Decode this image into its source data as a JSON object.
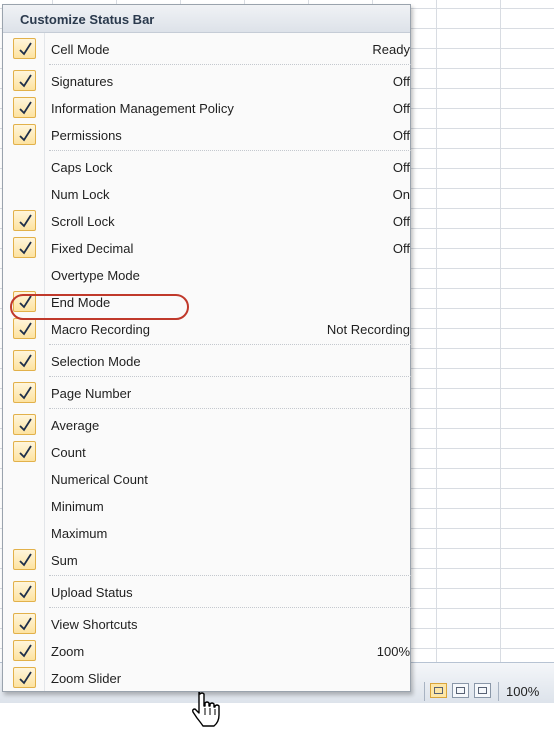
{
  "menu": {
    "title": "Customize Status Bar",
    "items": [
      {
        "label": "Cell Mode",
        "value": "Ready",
        "checked": true
      },
      {
        "label": "Signatures",
        "value": "Off",
        "checked": true
      },
      {
        "label": "Information Management Policy",
        "value": "Off",
        "checked": true
      },
      {
        "label": "Permissions",
        "value": "Off",
        "checked": true
      },
      {
        "label": "Caps Lock",
        "value": "Off",
        "checked": false
      },
      {
        "label": "Num Lock",
        "value": "On",
        "checked": false
      },
      {
        "label": "Scroll Lock",
        "value": "Off",
        "checked": true
      },
      {
        "label": "Fixed Decimal",
        "value": "Off",
        "checked": true
      },
      {
        "label": "Overtype Mode",
        "value": "",
        "checked": false
      },
      {
        "label": "End Mode",
        "value": "",
        "checked": true
      },
      {
        "label": "Macro Recording",
        "value": "Not Recording",
        "checked": true
      },
      {
        "label": "Selection Mode",
        "value": "",
        "checked": true
      },
      {
        "label": "Page Number",
        "value": "",
        "checked": true
      },
      {
        "label": "Average",
        "value": "",
        "checked": true
      },
      {
        "label": "Count",
        "value": "",
        "checked": true
      },
      {
        "label": "Numerical Count",
        "value": "",
        "checked": false
      },
      {
        "label": "Minimum",
        "value": "",
        "checked": false
      },
      {
        "label": "Maximum",
        "value": "",
        "checked": false
      },
      {
        "label": "Sum",
        "value": "",
        "checked": true
      },
      {
        "label": "Upload Status",
        "value": "",
        "checked": true
      },
      {
        "label": "View Shortcuts",
        "value": "",
        "checked": true
      },
      {
        "label": "Zoom",
        "value": "100%",
        "checked": true
      },
      {
        "label": "Zoom Slider",
        "value": "",
        "checked": true
      }
    ]
  },
  "statusbar": {
    "zoom": "100%",
    "views": [
      "normal-view",
      "page-layout-view",
      "page-break-preview"
    ]
  },
  "colors": {
    "check_fill": "#fde3a0",
    "check_border": "#e2b14a",
    "highlight_ring": "#c0392b"
  }
}
